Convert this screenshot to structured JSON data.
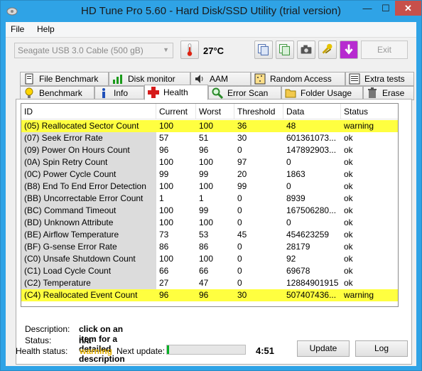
{
  "window": {
    "title": "HD Tune Pro 5.60 - Hard Disk/SSD Utility (trial version)",
    "min_glyph": "—",
    "max_glyph": "☐",
    "close_glyph": "✕"
  },
  "menu": {
    "file": "File",
    "help": "Help"
  },
  "toolbar": {
    "drive": "Seagate USB 3.0 Cable (500 gB)",
    "drive_arrow": "▼",
    "temperature": "27°C",
    "exit": "Exit"
  },
  "tabs_top": [
    {
      "label": "File Benchmark",
      "icon": "file-benchmark-icon"
    },
    {
      "label": "Disk monitor",
      "icon": "disk-monitor-icon"
    },
    {
      "label": "AAM",
      "icon": "speaker-icon"
    },
    {
      "label": "Random Access",
      "icon": "random-access-icon"
    },
    {
      "label": "Extra tests",
      "icon": "extra-tests-icon"
    }
  ],
  "tabs_bottom": [
    {
      "label": "Benchmark",
      "icon": "benchmark-icon"
    },
    {
      "label": "Info",
      "icon": "info-icon"
    },
    {
      "label": "Health",
      "icon": "health-cross-icon"
    },
    {
      "label": "Error Scan",
      "icon": "magnifier-icon"
    },
    {
      "label": "Folder Usage",
      "icon": "folder-icon"
    },
    {
      "label": "Erase",
      "icon": "trash-icon"
    }
  ],
  "grid": {
    "headers": [
      "ID",
      "Current",
      "Worst",
      "Threshold",
      "Data",
      "Status"
    ],
    "rows": [
      {
        "id": "(05) Reallocated Sector Count",
        "current": "100",
        "worst": "100",
        "threshold": "36",
        "data": "48",
        "status": "warning",
        "warn": true
      },
      {
        "id": "(07) Seek Error Rate",
        "current": "57",
        "worst": "51",
        "threshold": "30",
        "data": "601361073...",
        "status": "ok",
        "warn": false
      },
      {
        "id": "(09) Power On Hours Count",
        "current": "96",
        "worst": "96",
        "threshold": "0",
        "data": "147892903...",
        "status": "ok",
        "warn": false
      },
      {
        "id": "(0A) Spin Retry Count",
        "current": "100",
        "worst": "100",
        "threshold": "97",
        "data": "0",
        "status": "ok",
        "warn": false
      },
      {
        "id": "(0C) Power Cycle Count",
        "current": "99",
        "worst": "99",
        "threshold": "20",
        "data": "1863",
        "status": "ok",
        "warn": false
      },
      {
        "id": "(B8) End To End Error Detection",
        "current": "100",
        "worst": "100",
        "threshold": "99",
        "data": "0",
        "status": "ok",
        "warn": false
      },
      {
        "id": "(BB) Uncorrectable Error Count",
        "current": "1",
        "worst": "1",
        "threshold": "0",
        "data": "8939",
        "status": "ok",
        "warn": false
      },
      {
        "id": "(BC) Command Timeout",
        "current": "100",
        "worst": "99",
        "threshold": "0",
        "data": "167506280...",
        "status": "ok",
        "warn": false
      },
      {
        "id": "(BD) Unknown Attribute",
        "current": "100",
        "worst": "100",
        "threshold": "0",
        "data": "0",
        "status": "ok",
        "warn": false
      },
      {
        "id": "(BE) Airflow Temperature",
        "current": "73",
        "worst": "53",
        "threshold": "45",
        "data": "454623259",
        "status": "ok",
        "warn": false
      },
      {
        "id": "(BF) G-sense Error Rate",
        "current": "86",
        "worst": "86",
        "threshold": "0",
        "data": "28179",
        "status": "ok",
        "warn": false
      },
      {
        "id": "(C0) Unsafe Shutdown Count",
        "current": "100",
        "worst": "100",
        "threshold": "0",
        "data": "92",
        "status": "ok",
        "warn": false
      },
      {
        "id": "(C1) Load Cycle Count",
        "current": "66",
        "worst": "66",
        "threshold": "0",
        "data": "69678",
        "status": "ok",
        "warn": false
      },
      {
        "id": "(C2) Temperature",
        "current": "27",
        "worst": "47",
        "threshold": "0",
        "data": "12884901915",
        "status": "ok",
        "warn": false
      },
      {
        "id": "(C4) Reallocated Event Count",
        "current": "96",
        "worst": "96",
        "threshold": "30",
        "data": "507407436...",
        "status": "warning",
        "warn": true
      }
    ],
    "scroll_up": "▲",
    "scroll_down": "▼"
  },
  "description": {
    "label": "Description:",
    "value": "click on an item for a detailed description",
    "status_label": "Status:",
    "status_value": "n/a"
  },
  "footer": {
    "health_label": "Health status:",
    "health_value": "warning",
    "next_update_label": "Next update:",
    "progress": 0.03,
    "time": "4:51",
    "update_button": "Update",
    "log_button": "Log"
  },
  "colors": {
    "window_frame": "#2fa3e6",
    "warning_row": "#ffff40",
    "warning_text": "#e5b100",
    "progress_fill": "#06b025",
    "close_button": "#c7504b"
  }
}
